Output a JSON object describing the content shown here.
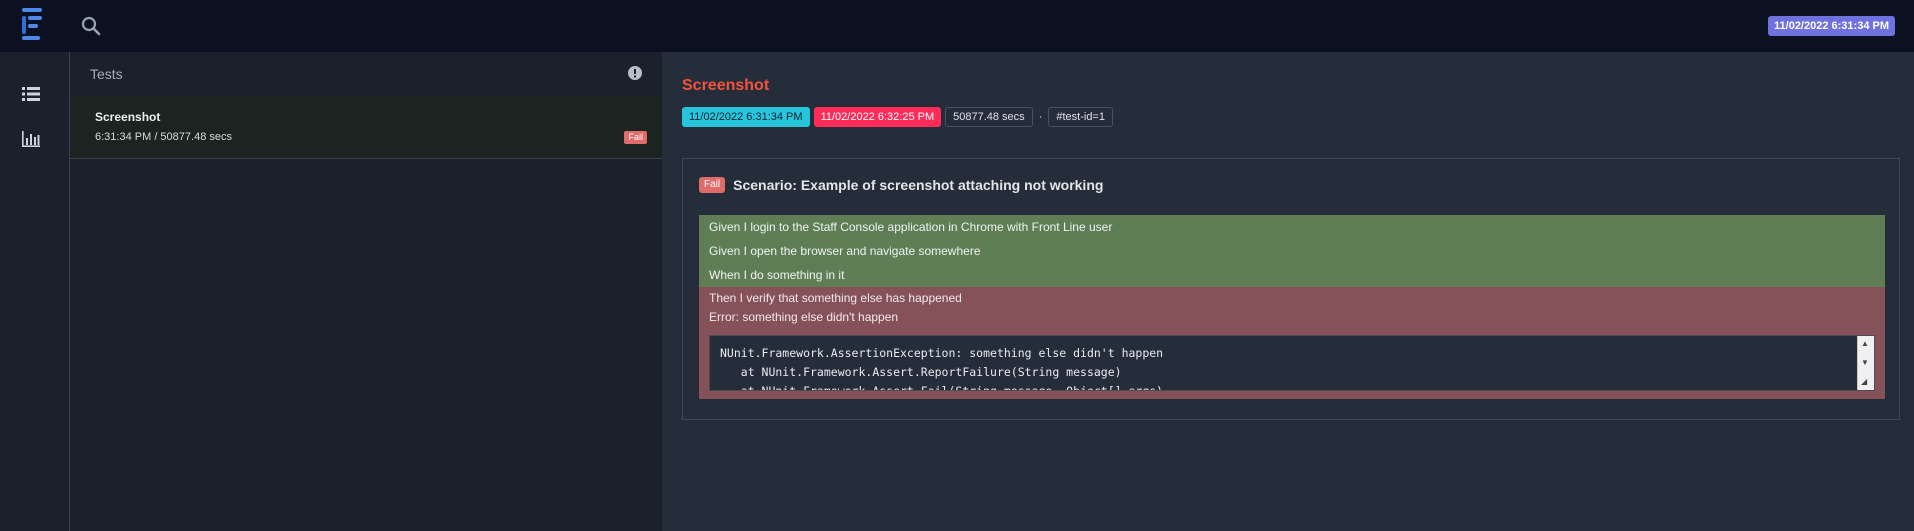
{
  "topbar": {
    "logo_icon": "extent-logo-icon",
    "search_icon": "search-icon",
    "timestamp": "11/02/2022 6:31:34 PM"
  },
  "sidenav": {
    "items": [
      {
        "icon": "list-icon"
      },
      {
        "icon": "bar-chart-icon"
      }
    ]
  },
  "test_list": {
    "header": "Tests",
    "info_icon": "exclamation-circle-icon",
    "items": [
      {
        "name": "Screenshot",
        "meta": "6:31:34 PM / 50877.48 secs",
        "status": "Fail"
      }
    ]
  },
  "detail": {
    "title": "Screenshot",
    "start": "11/02/2022 6:31:34 PM",
    "end": "11/02/2022 6:32:25 PM",
    "duration": "50877.48 secs",
    "separator": "·",
    "test_id": "#test-id=1",
    "scenario": {
      "status": "Fail",
      "title": "Scenario: Example of screenshot attaching not working",
      "passed_steps": [
        "Given I login to the Staff Console application in Chrome with Front Line user",
        "Given I open the browser and navigate somewhere",
        "When I do something in it"
      ],
      "failed_step": "Then I verify that something else has happened",
      "error": "Error: something else didn't happen",
      "stacktrace": "NUnit.Framework.AssertionException: something else didn't happen\n   at NUnit.Framework.Assert.ReportFailure(String message)\n   at NUnit.Framework.Assert.Fail(String message, Object[] args)"
    }
  },
  "colors": {
    "accent": "#6f71de",
    "fail": "#f3533a",
    "pass_bg": "#5f7e56",
    "fail_bg": "#85525a"
  }
}
